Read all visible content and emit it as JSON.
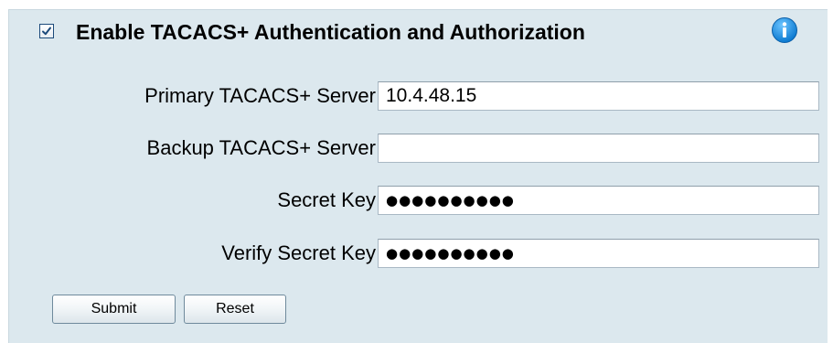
{
  "auth": {
    "enable_checked": true,
    "enable_label": "Enable TACACS+ Authentication and Authorization",
    "info_icon": "info-icon"
  },
  "fields": {
    "primary_server": {
      "label": "Primary TACACS+ Server",
      "value": "10.4.48.15"
    },
    "backup_server": {
      "label": "Backup TACACS+ Server",
      "value": ""
    },
    "secret_key": {
      "label": "Secret Key",
      "masked_value": "●●●●●●●●●●"
    },
    "verify_secret_key": {
      "label": "Verify Secret Key",
      "masked_value": "●●●●●●●●●●"
    }
  },
  "buttons": {
    "submit_label": "Submit",
    "reset_label": "Reset"
  },
  "colors": {
    "panel_background": "#dce8ee",
    "info_icon_blue": "#1a8fe0",
    "checkbox_border": "#1c4a7a"
  }
}
